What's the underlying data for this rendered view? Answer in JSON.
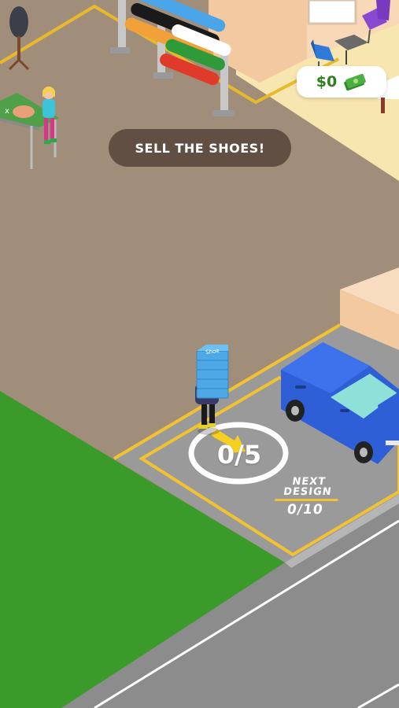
{
  "hud": {
    "money": "$0",
    "money_icon": "cash-stack-icon"
  },
  "instruction": {
    "text": "SELL THE SHOES!"
  },
  "sell_zone": {
    "counter": "0/5",
    "progress_fraction": 0
  },
  "next_design": {
    "line1": "NEXT",
    "line2": "DESIGN",
    "progress": "0/10",
    "progress_fraction": 0
  },
  "player": {
    "carry_box_label": "Shoe",
    "carried_boxes": 5
  },
  "colors": {
    "floor": "#a08e7a",
    "grass": "#3a9a2a",
    "road": "#8c8c8c",
    "parking": "#9a9a9a",
    "zone_line": "#f2c230",
    "van": "#2f5fd6",
    "box": "#4fa8e6",
    "money_text": "#2f7d1f",
    "room_floor": "#f7e6b0",
    "wall": "#f3c9a0"
  }
}
